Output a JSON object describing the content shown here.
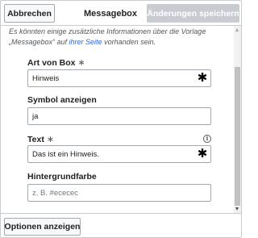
{
  "header": {
    "cancel_label": "Abbrechen",
    "title": "Messagebox",
    "save_label": "Änderungen speichern"
  },
  "notice": {
    "part1": "Es könnten einige zusätzliche Informationen über die Vorlage „Messagebox“ auf ",
    "link": "ihrer Seite",
    "part2": " vorhanden sein."
  },
  "fields": [
    {
      "label": "Art von Box",
      "required_marker": "∗",
      "value": "Hinweis",
      "placeholder": ""
    },
    {
      "label": "Symbol anzeigen",
      "value": "ja",
      "placeholder": ""
    },
    {
      "label": "Text",
      "required_marker": "∗",
      "value": "Das ist ein Hinweis.",
      "placeholder": "",
      "info_icon": "ⓘ"
    },
    {
      "label": "Hintergrundfarbe",
      "value": "",
      "placeholder": "z. B. #ececec"
    }
  ],
  "field_marker": "✱",
  "footer": {
    "options_label": "Optionen anzeigen"
  },
  "colors": {
    "link": "#3366cc",
    "border": "#a2a9b1",
    "disabled_button": "#c8ccd1"
  }
}
